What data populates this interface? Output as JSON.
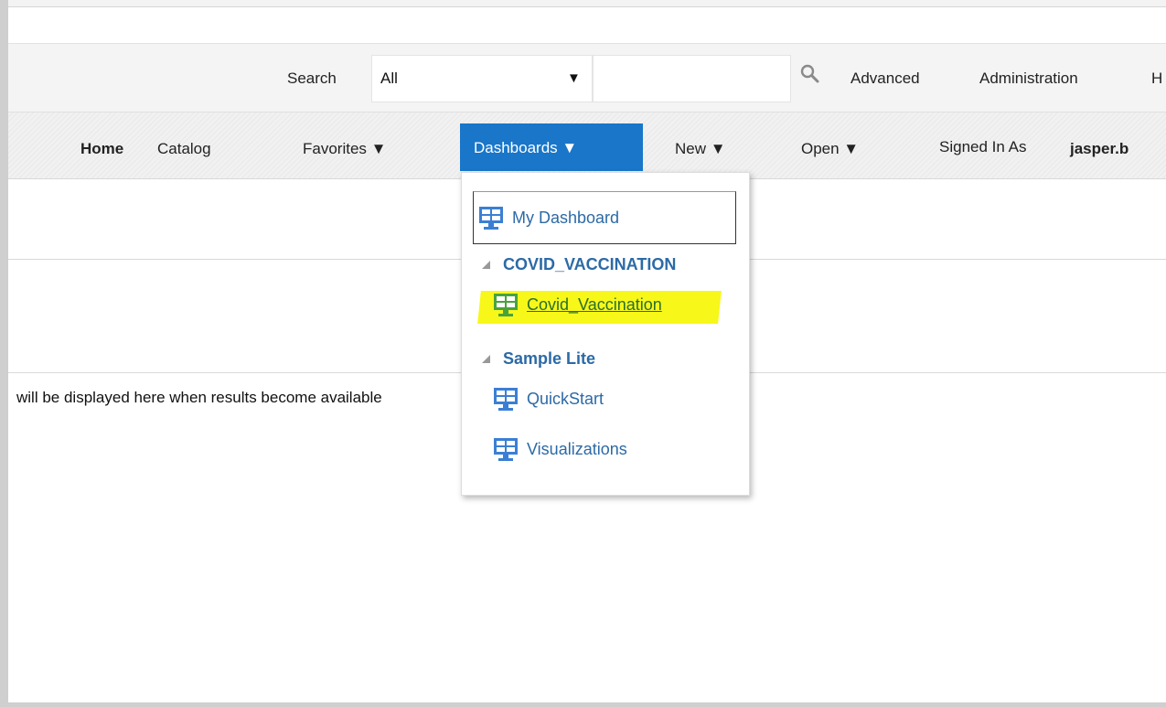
{
  "search": {
    "label": "Search",
    "scope_value": "All",
    "input_value": "",
    "advanced_label": "Advanced",
    "administration_label": "Administration",
    "cut_label": "H"
  },
  "nav": {
    "home": "Home",
    "catalog": "Catalog",
    "favorites": "Favorites ▼",
    "dashboards": "Dashboards ▼",
    "new": "New ▼",
    "open": "Open ▼",
    "signed_in_label": "Signed In As",
    "signed_in_user": "jasper.b"
  },
  "main": {
    "info_text": "will be displayed here when results become available"
  },
  "dropdown": {
    "my_dashboard": "My Dashboard",
    "groups": [
      {
        "name": "COVID_VACCINATION",
        "items": [
          "Covid_Vaccination"
        ]
      },
      {
        "name": "Sample Lite",
        "items": [
          "QuickStart",
          "Visualizations"
        ]
      }
    ]
  },
  "colors": {
    "accent": "#1976c9",
    "link": "#2c6aa6",
    "highlight": "#f7f71a",
    "dashboard_icon_blue": "#3b7fd4",
    "dashboard_icon_green": "#4aa33a"
  },
  "icons": {
    "search": "search-icon",
    "dashboard": "dashboard-icon",
    "collapse": "collapse-triangle-icon"
  }
}
